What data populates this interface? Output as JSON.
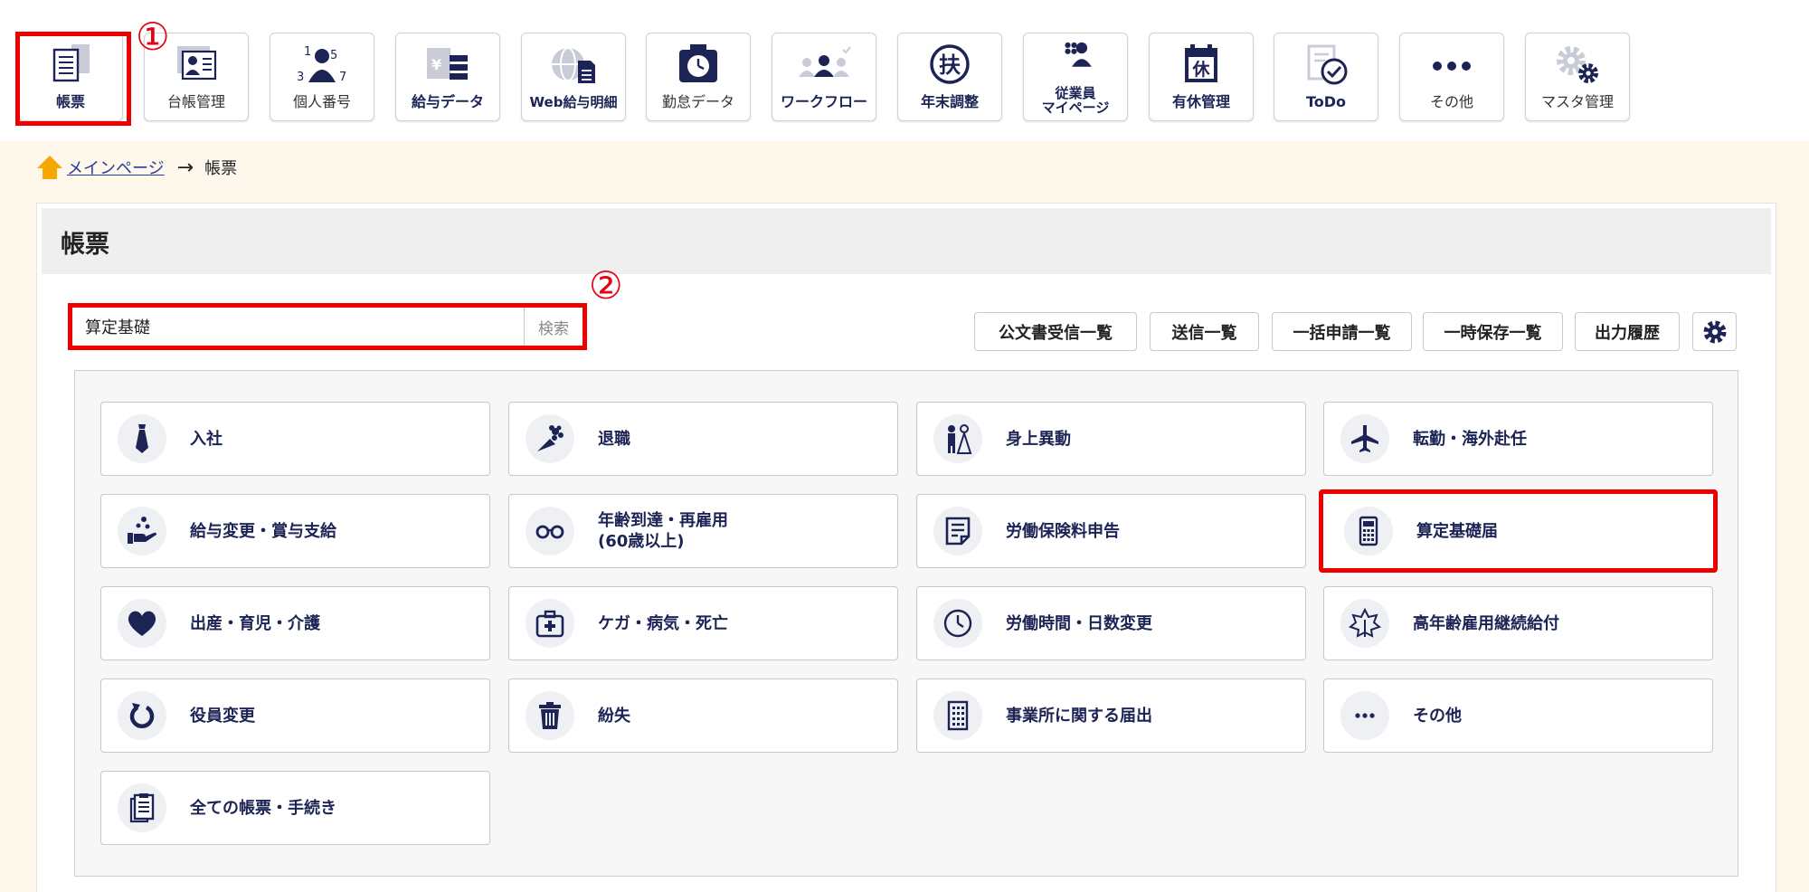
{
  "nav": {
    "items": [
      {
        "label": "帳票",
        "icon": "form-icon"
      },
      {
        "label": "台帳管理",
        "icon": "ledger-icon"
      },
      {
        "label": "個人番号",
        "icon": "personal-number-icon"
      },
      {
        "label": "給与データ",
        "icon": "payroll-data-icon"
      },
      {
        "label": "Web給与明細",
        "icon": "web-payslip-icon"
      },
      {
        "label": "勤怠データ",
        "icon": "attendance-icon"
      },
      {
        "label": "ワークフロー",
        "icon": "workflow-icon"
      },
      {
        "label": "年末調整",
        "icon": "year-end-adjustment-icon"
      },
      {
        "label": "従業員\nマイページ",
        "icon": "employee-mypage-icon"
      },
      {
        "label": "有休管理",
        "icon": "paid-leave-icon"
      },
      {
        "label": "ToDo",
        "icon": "todo-icon"
      },
      {
        "label": "その他",
        "icon": "more-icon"
      },
      {
        "label": "マスタ管理",
        "icon": "master-settings-icon"
      }
    ]
  },
  "annotations": {
    "one": "①",
    "two": "②"
  },
  "breadcrumb": {
    "home": "メインページ",
    "current": "帳票"
  },
  "panel": {
    "title": "帳票"
  },
  "search": {
    "value": "算定基礎",
    "button": "検索"
  },
  "tools": {
    "received": "公文書受信一覧",
    "sent": "送信一覧",
    "bulk": "一括申請一覧",
    "saved": "一時保存一覧",
    "history": "出力履歴"
  },
  "categories": [
    {
      "label": "入社",
      "icon": "necktie-icon"
    },
    {
      "label": "退職",
      "icon": "bouquet-icon"
    },
    {
      "label": "身上異動",
      "icon": "couple-icon"
    },
    {
      "label": "転勤・海外赴任",
      "icon": "airplane-icon"
    },
    {
      "label": "給与変更・賞与支給",
      "icon": "salary-hand-icon"
    },
    {
      "label": "年齢到達・再雇用\n(60歳以上)",
      "icon": "glasses-icon"
    },
    {
      "label": "労働保険料申告",
      "icon": "document-icon"
    },
    {
      "label": "算定基礎届",
      "icon": "calculator-icon"
    },
    {
      "label": "出産・育児・介護",
      "icon": "heart-icon"
    },
    {
      "label": "ケガ・病気・死亡",
      "icon": "first-aid-icon"
    },
    {
      "label": "労働時間・日数変更",
      "icon": "clock-icon"
    },
    {
      "label": "高年齢雇用継続給付",
      "icon": "leaf-icon"
    },
    {
      "label": "役員変更",
      "icon": "refresh-icon"
    },
    {
      "label": "紛失",
      "icon": "trash-icon"
    },
    {
      "label": "事業所に関する届出",
      "icon": "building-icon"
    },
    {
      "label": "その他",
      "icon": "more-icon"
    },
    {
      "label": "全ての帳票・手続き",
      "icon": "clipboard-icon"
    }
  ],
  "colors": {
    "navy": "#1c2455",
    "highlight": "#ee0000",
    "background": "#fdf7ec"
  }
}
